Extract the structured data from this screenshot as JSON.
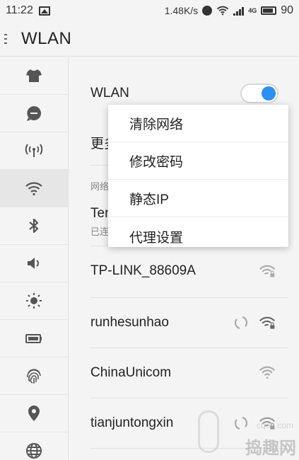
{
  "status_bar": {
    "time": "11:22",
    "speed": "1.48K/s",
    "network": "4G",
    "battery": "90"
  },
  "title_bar": {
    "title": "WLAN"
  },
  "sidebar": {
    "items": [
      {
        "icon": "shirt-icon",
        "active": false
      },
      {
        "icon": "chat-bubble-icon",
        "active": false
      },
      {
        "icon": "hotspot-icon",
        "active": false
      },
      {
        "icon": "wifi-icon",
        "active": true
      },
      {
        "icon": "bluetooth-icon",
        "active": false
      },
      {
        "icon": "volume-icon",
        "active": false
      },
      {
        "icon": "brightness-icon",
        "active": false
      },
      {
        "icon": "battery-icon",
        "active": false
      },
      {
        "icon": "fingerprint-icon",
        "active": false
      },
      {
        "icon": "location-icon",
        "active": false
      },
      {
        "icon": "globe-icon",
        "active": false
      }
    ]
  },
  "main": {
    "wlan_label": "WLAN",
    "wlan_enabled": true,
    "more_label_partial": "更多",
    "section_label_partial": "网络",
    "connected": {
      "name_partial": "Ten",
      "status_partial": "已连"
    },
    "networks": [
      {
        "name": "TP-LINK_88609A",
        "secured": true
      },
      {
        "name": "runhesunhao",
        "secured": true,
        "connecting": true
      },
      {
        "name": "ChinaUnicom",
        "secured": false
      },
      {
        "name": "tianjuntongxin",
        "secured": true,
        "connecting": true
      }
    ]
  },
  "popup_menu": {
    "items": [
      "清除网络",
      "修改密码",
      "静态IP",
      "代理设置"
    ]
  },
  "watermark": {
    "text": "捣趣网",
    "site": "cqoo.com"
  },
  "colors": {
    "accent": "#2d8ff0",
    "background": "#f4f4f4"
  }
}
